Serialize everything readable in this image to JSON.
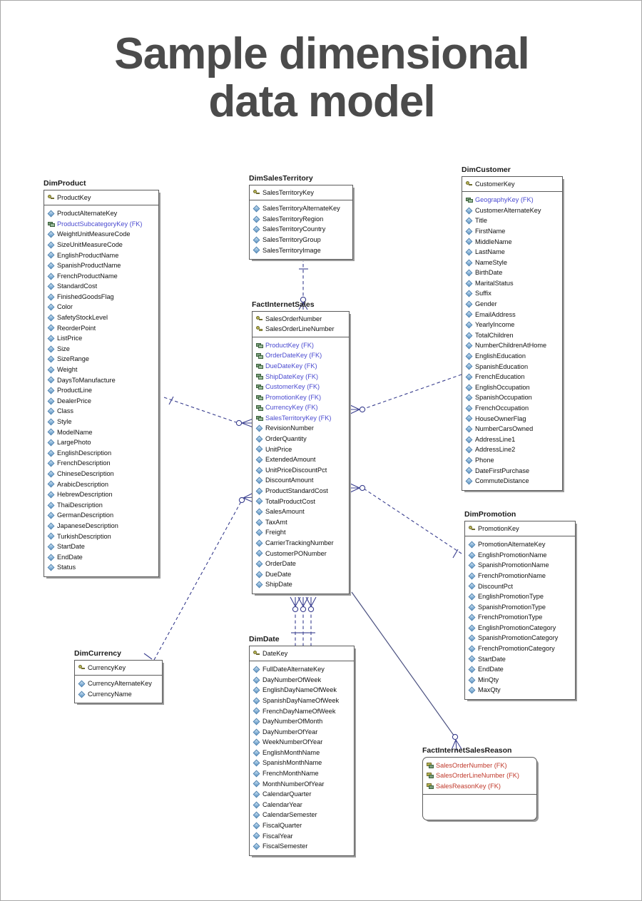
{
  "title": "Sample dimensional\ndata model",
  "colors": {
    "title": "#4b4b4b",
    "fk_text": "#4a4ad0",
    "pkfk_text": "#c0392b",
    "entity_border": "#5b5b5b",
    "connector": "#3a3f8f",
    "connector_solid": "#4a5080",
    "page_border": "#a8a8a8"
  },
  "entities": [
    {
      "id": "dim-product",
      "name": "DimProduct",
      "style": "square",
      "pk": [
        {
          "label": "ProductKey",
          "kind": "pk"
        }
      ],
      "attrs": [
        {
          "label": "ProductAlternateKey",
          "kind": "attr"
        },
        {
          "label": "ProductSubcategoryKey (FK)",
          "kind": "fk"
        },
        {
          "label": "WeightUnitMeasureCode",
          "kind": "attr"
        },
        {
          "label": "SizeUnitMeasureCode",
          "kind": "attr"
        },
        {
          "label": "EnglishProductName",
          "kind": "attr"
        },
        {
          "label": "SpanishProductName",
          "kind": "attr"
        },
        {
          "label": "FrenchProductName",
          "kind": "attr"
        },
        {
          "label": "StandardCost",
          "kind": "attr"
        },
        {
          "label": "FinishedGoodsFlag",
          "kind": "attr"
        },
        {
          "label": "Color",
          "kind": "attr"
        },
        {
          "label": "SafetyStockLevel",
          "kind": "attr"
        },
        {
          "label": "ReorderPoint",
          "kind": "attr"
        },
        {
          "label": "ListPrice",
          "kind": "attr"
        },
        {
          "label": "Size",
          "kind": "attr"
        },
        {
          "label": "SizeRange",
          "kind": "attr"
        },
        {
          "label": "Weight",
          "kind": "attr"
        },
        {
          "label": "DaysToManufacture",
          "kind": "attr"
        },
        {
          "label": "ProductLine",
          "kind": "attr"
        },
        {
          "label": "DealerPrice",
          "kind": "attr"
        },
        {
          "label": "Class",
          "kind": "attr"
        },
        {
          "label": "Style",
          "kind": "attr"
        },
        {
          "label": "ModelName",
          "kind": "attr"
        },
        {
          "label": "LargePhoto",
          "kind": "attr"
        },
        {
          "label": "EnglishDescription",
          "kind": "attr"
        },
        {
          "label": "FrenchDescription",
          "kind": "attr"
        },
        {
          "label": "ChineseDescription",
          "kind": "attr"
        },
        {
          "label": "ArabicDescription",
          "kind": "attr"
        },
        {
          "label": "HebrewDescription",
          "kind": "attr"
        },
        {
          "label": "ThaiDescription",
          "kind": "attr"
        },
        {
          "label": "GermanDescription",
          "kind": "attr"
        },
        {
          "label": "JapaneseDescription",
          "kind": "attr"
        },
        {
          "label": "TurkishDescription",
          "kind": "attr"
        },
        {
          "label": "StartDate",
          "kind": "attr"
        },
        {
          "label": "EndDate",
          "kind": "attr"
        },
        {
          "label": "Status",
          "kind": "attr"
        }
      ]
    },
    {
      "id": "dim-sales-territory",
      "name": "DimSalesTerritory",
      "style": "square",
      "pk": [
        {
          "label": "SalesTerritoryKey",
          "kind": "pk"
        }
      ],
      "attrs": [
        {
          "label": "SalesTerritoryAlternateKey",
          "kind": "attr"
        },
        {
          "label": "SalesTerritoryRegion",
          "kind": "attr"
        },
        {
          "label": "SalesTerritoryCountry",
          "kind": "attr"
        },
        {
          "label": "SalesTerritoryGroup",
          "kind": "attr"
        },
        {
          "label": "SalesTerritoryImage",
          "kind": "attr"
        }
      ]
    },
    {
      "id": "dim-customer",
      "name": "DimCustomer",
      "style": "square",
      "pk": [
        {
          "label": "CustomerKey",
          "kind": "pk"
        }
      ],
      "attrs": [
        {
          "label": "GeographyKey (FK)",
          "kind": "fk"
        },
        {
          "label": "CustomerAlternateKey",
          "kind": "attr"
        },
        {
          "label": "Title",
          "kind": "attr"
        },
        {
          "label": "FirstName",
          "kind": "attr"
        },
        {
          "label": "MiddleName",
          "kind": "attr"
        },
        {
          "label": "LastName",
          "kind": "attr"
        },
        {
          "label": "NameStyle",
          "kind": "attr"
        },
        {
          "label": "BirthDate",
          "kind": "attr"
        },
        {
          "label": "MaritalStatus",
          "kind": "attr"
        },
        {
          "label": "Suffix",
          "kind": "attr"
        },
        {
          "label": "Gender",
          "kind": "attr"
        },
        {
          "label": "EmailAddress",
          "kind": "attr"
        },
        {
          "label": "YearlyIncome",
          "kind": "attr"
        },
        {
          "label": "TotalChildren",
          "kind": "attr"
        },
        {
          "label": "NumberChildrenAtHome",
          "kind": "attr"
        },
        {
          "label": "EnglishEducation",
          "kind": "attr"
        },
        {
          "label": "SpanishEducation",
          "kind": "attr"
        },
        {
          "label": "FrenchEducation",
          "kind": "attr"
        },
        {
          "label": "EnglishOccupation",
          "kind": "attr"
        },
        {
          "label": "SpanishOccupation",
          "kind": "attr"
        },
        {
          "label": "FrenchOccupation",
          "kind": "attr"
        },
        {
          "label": "HouseOwnerFlag",
          "kind": "attr"
        },
        {
          "label": "NumberCarsOwned",
          "kind": "attr"
        },
        {
          "label": "AddressLine1",
          "kind": "attr"
        },
        {
          "label": "AddressLine2",
          "kind": "attr"
        },
        {
          "label": "Phone",
          "kind": "attr"
        },
        {
          "label": "DateFirstPurchase",
          "kind": "attr"
        },
        {
          "label": "CommuteDistance",
          "kind": "attr"
        }
      ]
    },
    {
      "id": "fact-internet-sales",
      "name": "FactInternetSales",
      "style": "square",
      "pk": [
        {
          "label": "SalesOrderNumber",
          "kind": "pk"
        },
        {
          "label": "SalesOrderLineNumber",
          "kind": "pk"
        }
      ],
      "attrs": [
        {
          "label": "ProductKey (FK)",
          "kind": "fk"
        },
        {
          "label": "OrderDateKey (FK)",
          "kind": "fk"
        },
        {
          "label": "DueDateKey (FK)",
          "kind": "fk"
        },
        {
          "label": "ShipDateKey (FK)",
          "kind": "fk"
        },
        {
          "label": "CustomerKey (FK)",
          "kind": "fk"
        },
        {
          "label": "PromotionKey (FK)",
          "kind": "fk"
        },
        {
          "label": "CurrencyKey (FK)",
          "kind": "fk"
        },
        {
          "label": "SalesTerritoryKey (FK)",
          "kind": "fk"
        },
        {
          "label": "RevisionNumber",
          "kind": "attr"
        },
        {
          "label": "OrderQuantity",
          "kind": "attr"
        },
        {
          "label": "UnitPrice",
          "kind": "attr"
        },
        {
          "label": "ExtendedAmount",
          "kind": "attr"
        },
        {
          "label": "UnitPriceDiscountPct",
          "kind": "attr"
        },
        {
          "label": "DiscountAmount",
          "kind": "attr"
        },
        {
          "label": "ProductStandardCost",
          "kind": "attr"
        },
        {
          "label": "TotalProductCost",
          "kind": "attr"
        },
        {
          "label": "SalesAmount",
          "kind": "attr"
        },
        {
          "label": "TaxAmt",
          "kind": "attr"
        },
        {
          "label": "Freight",
          "kind": "attr"
        },
        {
          "label": "CarrierTrackingNumber",
          "kind": "attr"
        },
        {
          "label": "CustomerPONumber",
          "kind": "attr"
        },
        {
          "label": "OrderDate",
          "kind": "attr"
        },
        {
          "label": "DueDate",
          "kind": "attr"
        },
        {
          "label": "ShipDate",
          "kind": "attr"
        }
      ]
    },
    {
      "id": "dim-promotion",
      "name": "DimPromotion",
      "style": "square",
      "pk": [
        {
          "label": "PromotionKey",
          "kind": "pk"
        }
      ],
      "attrs": [
        {
          "label": "PromotionAlternateKey",
          "kind": "attr"
        },
        {
          "label": "EnglishPromotionName",
          "kind": "attr"
        },
        {
          "label": "SpanishPromotionName",
          "kind": "attr"
        },
        {
          "label": "FrenchPromotionName",
          "kind": "attr"
        },
        {
          "label": "DiscountPct",
          "kind": "attr"
        },
        {
          "label": "EnglishPromotionType",
          "kind": "attr"
        },
        {
          "label": "SpanishPromotionType",
          "kind": "attr"
        },
        {
          "label": "FrenchPromotionType",
          "kind": "attr"
        },
        {
          "label": "EnglishPromotionCategory",
          "kind": "attr"
        },
        {
          "label": "SpanishPromotionCategory",
          "kind": "attr"
        },
        {
          "label": "FrenchPromotionCategory",
          "kind": "attr"
        },
        {
          "label": "StartDate",
          "kind": "attr"
        },
        {
          "label": "EndDate",
          "kind": "attr"
        },
        {
          "label": "MinQty",
          "kind": "attr"
        },
        {
          "label": "MaxQty",
          "kind": "attr"
        }
      ]
    },
    {
      "id": "dim-currency",
      "name": "DimCurrency",
      "style": "square",
      "pk": [
        {
          "label": "CurrencyKey",
          "kind": "pk"
        }
      ],
      "attrs": [
        {
          "label": "CurrencyAlternateKey",
          "kind": "attr"
        },
        {
          "label": "CurrencyName",
          "kind": "attr"
        }
      ]
    },
    {
      "id": "dim-date",
      "name": "DimDate",
      "style": "square",
      "pk": [
        {
          "label": "DateKey",
          "kind": "pk"
        }
      ],
      "attrs": [
        {
          "label": "FullDateAlternateKey",
          "kind": "attr"
        },
        {
          "label": "DayNumberOfWeek",
          "kind": "attr"
        },
        {
          "label": "EnglishDayNameOfWeek",
          "kind": "attr"
        },
        {
          "label": "SpanishDayNameOfWeek",
          "kind": "attr"
        },
        {
          "label": "FrenchDayNameOfWeek",
          "kind": "attr"
        },
        {
          "label": "DayNumberOfMonth",
          "kind": "attr"
        },
        {
          "label": "DayNumberOfYear",
          "kind": "attr"
        },
        {
          "label": "WeekNumberOfYear",
          "kind": "attr"
        },
        {
          "label": "EnglishMonthName",
          "kind": "attr"
        },
        {
          "label": "SpanishMonthName",
          "kind": "attr"
        },
        {
          "label": "FrenchMonthName",
          "kind": "attr"
        },
        {
          "label": "MonthNumberOfYear",
          "kind": "attr"
        },
        {
          "label": "CalendarQuarter",
          "kind": "attr"
        },
        {
          "label": "CalendarYear",
          "kind": "attr"
        },
        {
          "label": "CalendarSemester",
          "kind": "attr"
        },
        {
          "label": "FiscalQuarter",
          "kind": "attr"
        },
        {
          "label": "FiscalYear",
          "kind": "attr"
        },
        {
          "label": "FiscalSemester",
          "kind": "attr"
        }
      ]
    },
    {
      "id": "fact-internet-sales-reason",
      "name": "FactInternetSalesReason",
      "style": "rounded",
      "pk": [
        {
          "label": "SalesOrderNumber (FK)",
          "kind": "pkfk"
        },
        {
          "label": "SalesOrderLineNumber (FK)",
          "kind": "pkfk"
        },
        {
          "label": "SalesReasonKey (FK)",
          "kind": "pkfk"
        }
      ],
      "attrs": []
    }
  ],
  "relationships": [
    {
      "from": "DimProduct",
      "to": "FactInternetSales",
      "type": "non-identifying",
      "cardinality": "zero-or-many"
    },
    {
      "from": "DimSalesTerritory",
      "to": "FactInternetSales",
      "type": "non-identifying",
      "cardinality": "zero-or-many"
    },
    {
      "from": "DimCustomer",
      "to": "FactInternetSales",
      "type": "non-identifying",
      "cardinality": "zero-or-many"
    },
    {
      "from": "DimPromotion",
      "to": "FactInternetSales",
      "type": "non-identifying",
      "cardinality": "zero-or-many"
    },
    {
      "from": "DimCurrency",
      "to": "FactInternetSales",
      "type": "non-identifying",
      "cardinality": "zero-or-many"
    },
    {
      "from": "DimDate",
      "to": "FactInternetSales",
      "type": "non-identifying",
      "cardinality": "zero-or-many",
      "count": 3
    },
    {
      "from": "FactInternetSales",
      "to": "FactInternetSalesReason",
      "type": "identifying",
      "cardinality": "zero-or-many"
    }
  ]
}
